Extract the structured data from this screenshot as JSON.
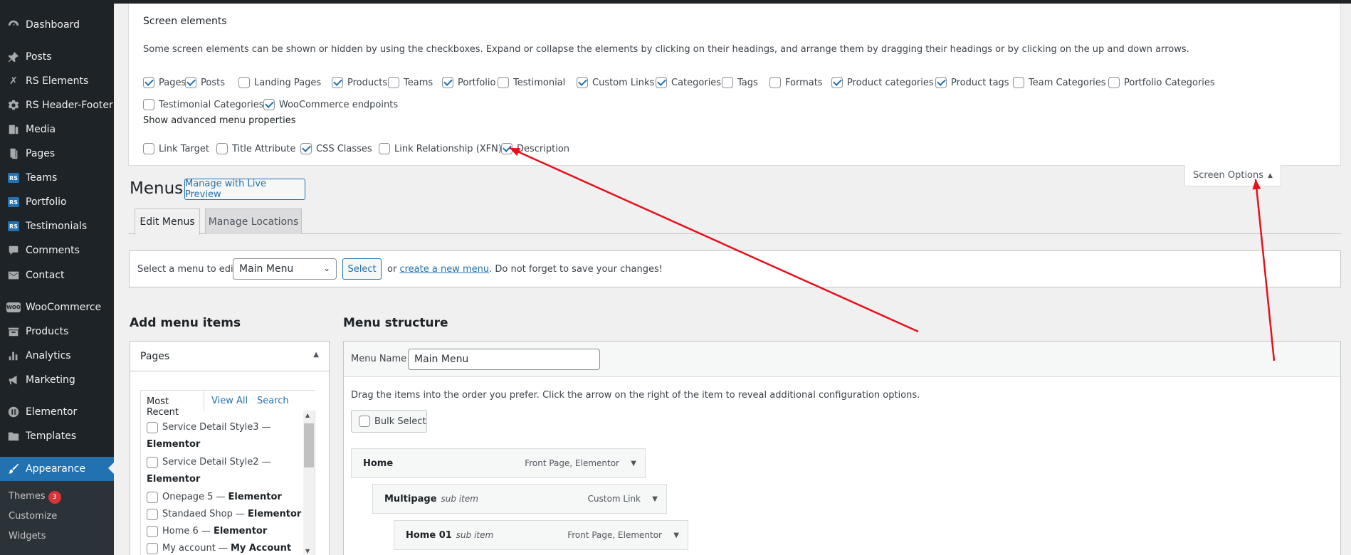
{
  "sidebar": {
    "items": [
      {
        "label": "Dashboard",
        "icon": "dashboard-icon"
      },
      {
        "label": "Posts",
        "icon": "pin-icon"
      },
      {
        "label": "RS Elements",
        "icon": "rs-elements-icon"
      },
      {
        "label": "RS Header-Footer",
        "icon": "rs-header-footer-icon"
      },
      {
        "label": "Media",
        "icon": "media-icon"
      },
      {
        "label": "Pages",
        "icon": "pages-icon"
      },
      {
        "label": "Teams",
        "icon": "rs-badge-icon",
        "badge": "RS"
      },
      {
        "label": "Portfolio",
        "icon": "rs-badge-icon",
        "badge": "RS"
      },
      {
        "label": "Testimonials",
        "icon": "rs-badge-icon",
        "badge": "RS"
      },
      {
        "label": "Comments",
        "icon": "comment-icon"
      },
      {
        "label": "Contact",
        "icon": "mail-icon"
      },
      {
        "label": "WooCommerce",
        "icon": "woocommerce-icon",
        "badge": "WOO"
      },
      {
        "label": "Products",
        "icon": "products-icon"
      },
      {
        "label": "Analytics",
        "icon": "analytics-icon"
      },
      {
        "label": "Marketing",
        "icon": "megaphone-icon"
      },
      {
        "label": "Elementor",
        "icon": "elementor-icon"
      },
      {
        "label": "Templates",
        "icon": "folder-icon"
      },
      {
        "label": "Appearance",
        "icon": "brush-icon"
      }
    ],
    "submenu": [
      {
        "label": "Themes",
        "badge": "3"
      },
      {
        "label": "Customize"
      },
      {
        "label": "Widgets"
      }
    ]
  },
  "screen_options": {
    "heading": "Screen elements",
    "description": "Some screen elements can be shown or hidden by using the checkboxes. Expand or collapse the elements by clicking on their headings, and arrange them by dragging their headings or by clicking on the up and down arrows.",
    "elements": [
      {
        "label": "Pages",
        "checked": true
      },
      {
        "label": "Posts",
        "checked": true
      },
      {
        "label": "Landing Pages",
        "checked": false
      },
      {
        "label": "Products",
        "checked": true
      },
      {
        "label": "Teams",
        "checked": false
      },
      {
        "label": "Portfolio",
        "checked": true
      },
      {
        "label": "Testimonial",
        "checked": false
      },
      {
        "label": "Custom Links",
        "checked": true
      },
      {
        "label": "Categories",
        "checked": true
      },
      {
        "label": "Tags",
        "checked": false
      },
      {
        "label": "Formats",
        "checked": false
      },
      {
        "label": "Product categories",
        "checked": true
      },
      {
        "label": "Product tags",
        "checked": true
      },
      {
        "label": "Team Categories",
        "checked": false
      },
      {
        "label": "Portfolio Categories",
        "checked": false
      },
      {
        "label": "Testimonial Categories",
        "checked": false
      },
      {
        "label": "WooCommerce endpoints",
        "checked": true
      }
    ],
    "advanced_heading": "Show advanced menu properties",
    "advanced": [
      {
        "label": "Link Target",
        "checked": false
      },
      {
        "label": "Title Attribute",
        "checked": false
      },
      {
        "label": "CSS Classes",
        "checked": true
      },
      {
        "label": "Link Relationship (XFN)",
        "checked": false
      },
      {
        "label": "Description",
        "checked": true
      }
    ],
    "tab_label": "Screen Options"
  },
  "page": {
    "title": "Menus",
    "live_preview_button": "Manage with Live Preview",
    "tabs": [
      "Edit Menus",
      "Manage Locations"
    ],
    "select_label": "Select a menu to edit:",
    "select_value": "Main Menu",
    "select_button": "Select",
    "or_text": "or",
    "create_link": "create a new menu",
    "save_hint": ". Do not forget to save your changes!"
  },
  "add_items": {
    "heading": "Add menu items",
    "panel_title": "Pages",
    "tabs": [
      "Most Recent",
      "View All",
      "Search"
    ],
    "pages": [
      {
        "name": "Service Detail Style3 —",
        "builder": "Elementor"
      },
      {
        "name": "Service Detail Style2 —",
        "builder": "Elementor"
      },
      {
        "name": "Onepage 5 —",
        "builder": "Elementor"
      },
      {
        "name": "Standaed Shop —",
        "builder": "Elementor"
      },
      {
        "name": "Home 6 —",
        "builder": "Elementor"
      },
      {
        "name": "My account —",
        "builder": "My Account"
      }
    ]
  },
  "structure": {
    "heading": "Menu structure",
    "name_label": "Menu Name",
    "name_value": "Main Menu",
    "instructions": "Drag the items into the order you prefer. Click the arrow on the right of the item to reveal additional configuration options.",
    "bulk_select": "Bulk Select",
    "items": [
      {
        "title": "Home",
        "sub": "",
        "type": "Front Page, Elementor"
      },
      {
        "title": "Multipage",
        "sub": "sub item",
        "type": "Custom Link"
      },
      {
        "title": "Home 01",
        "sub": "sub item",
        "type": "Front Page, Elementor"
      }
    ]
  },
  "annotation_color": "#e8101a"
}
